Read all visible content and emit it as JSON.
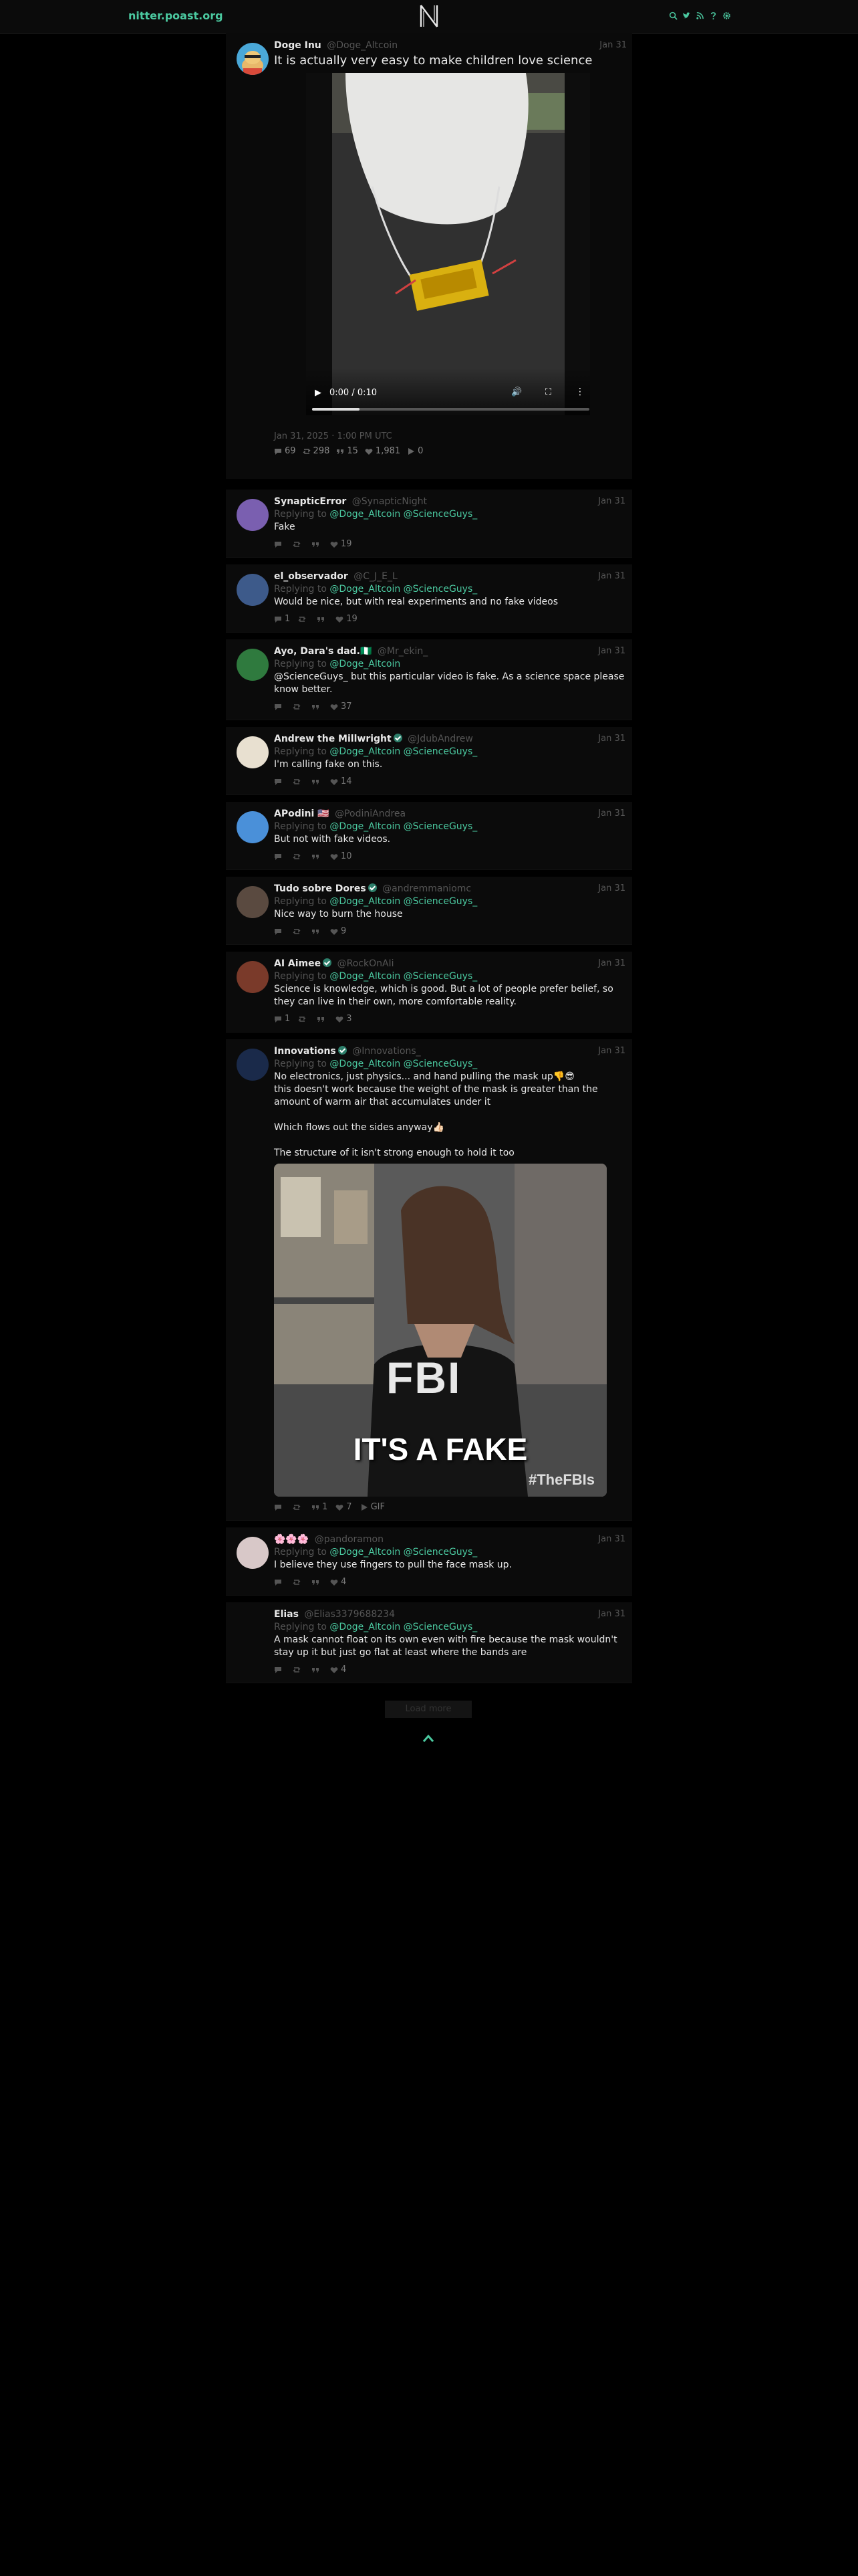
{
  "nav": {
    "site_name": "nitter.poast.org",
    "icons": [
      "search-icon",
      "twitter-icon",
      "rss-icon",
      "help-icon",
      "settings-icon"
    ]
  },
  "colors": {
    "accent": "#4bc9a0",
    "background": "#000000",
    "panel": "#0b0b0b",
    "muted": "#555555"
  },
  "main_tweet": {
    "fullname": "Doge Inu",
    "handle": "@Doge_Altcoin",
    "date": "Jan 31",
    "text": "It is actually very easy to make children love science",
    "video": {
      "time": "0:00 / 0:10",
      "progress": 0.17
    },
    "published": "Jan 31, 2025 · 1:00 PM UTC",
    "stats": {
      "replies": "69",
      "retweets": "298",
      "quotes": "15",
      "likes": "1,981",
      "views": "0"
    }
  },
  "replies": [
    {
      "fullname": "SynapticError",
      "handle": "@SynapticNight",
      "date": "Jan 31",
      "verified": false,
      "replying_label": "Replying to",
      "replying_to": [
        "@Doge_Altcoin",
        "@ScienceGuys_"
      ],
      "text": "Fake",
      "stats": {
        "replies": "",
        "retweets": "",
        "quotes": "",
        "likes": "19"
      },
      "avatar_color": "#7a5fb0"
    },
    {
      "fullname": "el_observador",
      "handle": "@C_J_E_L",
      "date": "Jan 31",
      "verified": false,
      "replying_label": "Replying to",
      "replying_to": [
        "@Doge_Altcoin",
        "@ScienceGuys_"
      ],
      "text": "Would be nice, but with real experiments and no fake videos",
      "stats": {
        "replies": "1",
        "retweets": "",
        "quotes": "",
        "likes": "19"
      },
      "avatar_color": "#3d5a8a"
    },
    {
      "fullname": "Ayo, Dara's dad.🇳🇬",
      "handle": "@Mr_ekin_",
      "date": "Jan 31",
      "verified": false,
      "replying_label": "Replying to",
      "replying_to": [
        "@Doge_Altcoin"
      ],
      "text": "@ScienceGuys_  but this particular video is fake. As a science space please know better.",
      "stats": {
        "replies": "",
        "retweets": "",
        "quotes": "",
        "likes": "37"
      },
      "avatar_color": "#2f7a3e"
    },
    {
      "fullname": "Andrew the Millwright",
      "handle": "@JdubAndrew",
      "date": "Jan 31",
      "verified": true,
      "replying_label": "Replying to",
      "replying_to": [
        "@Doge_Altcoin",
        "@ScienceGuys_"
      ],
      "text": "I'm calling fake on this.",
      "stats": {
        "replies": "",
        "retweets": "",
        "quotes": "",
        "likes": "14"
      },
      "avatar_color": "#e8e0d0"
    },
    {
      "fullname": "APodini 🇺🇸",
      "handle": "@PodiniAndrea",
      "date": "Jan 31",
      "verified": false,
      "replying_label": "Replying to",
      "replying_to": [
        "@Doge_Altcoin",
        "@ScienceGuys_"
      ],
      "text": "But not with fake videos.",
      "stats": {
        "replies": "",
        "retweets": "",
        "quotes": "",
        "likes": "10"
      },
      "avatar_color": "#4a90d9"
    },
    {
      "fullname": "Tudo sobre Dores",
      "handle": "@andremmaniomc",
      "date": "Jan 31",
      "verified": true,
      "replying_label": "Replying to",
      "replying_to": [
        "@Doge_Altcoin",
        "@ScienceGuys_"
      ],
      "text": "Nice way to burn the house",
      "stats": {
        "replies": "",
        "retweets": "",
        "quotes": "",
        "likes": "9"
      },
      "avatar_color": "#5a4a40"
    },
    {
      "fullname": "AI Aimee",
      "handle": "@RockOnAIi",
      "date": "Jan 31",
      "verified": true,
      "replying_label": "Replying to",
      "replying_to": [
        "@Doge_Altcoin",
        "@ScienceGuys_"
      ],
      "text": "Science is knowledge, which is good. But a lot of people prefer belief, so they can live in their own, more comfortable reality.",
      "stats": {
        "replies": "1",
        "retweets": "",
        "quotes": "",
        "likes": "3"
      },
      "avatar_color": "#7a3a2a"
    },
    {
      "fullname": "Innovations",
      "handle": "@Innovations_",
      "date": "Jan 31",
      "verified": true,
      "replying_label": "Replying to",
      "replying_to": [
        "@Doge_Altcoin",
        "@ScienceGuys_"
      ],
      "text": "No electronics, just physics... and hand pulling the mask up👎😎\nthis doesn't work because the weight of the mask is greater than the amount of warm air that accumulates under it\n\nWhich flows out the sides anyway👍🏻\n\nThe structure of it isn't strong enough to hold it too",
      "gif": {
        "caption": "IT'S A FAKE",
        "badge": "FBI",
        "tag": "#TheFBIs"
      },
      "stats": {
        "replies": "",
        "retweets": "",
        "quotes": "1",
        "likes": "7",
        "gif": "GIF"
      },
      "avatar_color": "#1a2a4a"
    },
    {
      "fullname": "🌸🌸🌸",
      "handle": "@pandoramon",
      "date": "Jan 31",
      "verified": false,
      "replying_label": "Replying to",
      "replying_to": [
        "@Doge_Altcoin",
        "@ScienceGuys_"
      ],
      "text": "I believe they use fingers to pull the face mask up.",
      "stats": {
        "replies": "",
        "retweets": "",
        "quotes": "",
        "likes": "4"
      },
      "avatar_color": "#d8c8c8"
    },
    {
      "fullname": "Elias",
      "handle": "@Elias3379688234",
      "date": "Jan 31",
      "verified": false,
      "replying_label": "Replying to",
      "replying_to": [
        "@Doge_Altcoin",
        "@ScienceGuys_"
      ],
      "text": "A mask cannot float on its own even with fire because the mask wouldn't stay up it but just go flat at least where the bands are",
      "stats": {
        "replies": "",
        "retweets": "",
        "quotes": "",
        "likes": "4"
      },
      "avatar_color": ""
    }
  ],
  "load_more": "Load more"
}
